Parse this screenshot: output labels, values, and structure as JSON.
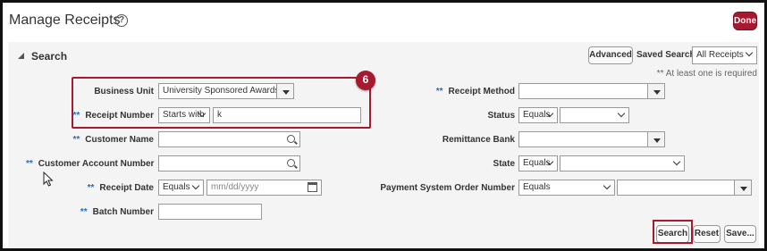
{
  "header": {
    "title": "Manage Receipts",
    "help_icon": "?",
    "done_label": "Done"
  },
  "search": {
    "section_title": "Search",
    "advanced_label": "Advanced",
    "saved_search_label": "Saved Search",
    "saved_search_value": "All Receipts",
    "at_least_one_note": "** At least one is required",
    "required_marker": "**",
    "fields": {
      "business_unit": {
        "label": "Business Unit",
        "value": "University Sponsored Awards"
      },
      "receipt_number": {
        "label": "Receipt Number",
        "operator": "Starts with",
        "value": "k"
      },
      "customer_name": {
        "label": "Customer Name",
        "value": ""
      },
      "customer_account_number": {
        "label": "Customer Account Number",
        "value": ""
      },
      "receipt_date": {
        "label": "Receipt Date",
        "operator": "Equals",
        "placeholder": "mm/dd/yyyy"
      },
      "batch_number": {
        "label": "Batch Number",
        "value": ""
      },
      "receipt_method": {
        "label": "Receipt Method",
        "value": ""
      },
      "status": {
        "label": "Status",
        "operator": "Equals",
        "value": ""
      },
      "remittance_bank": {
        "label": "Remittance Bank",
        "value": ""
      },
      "state": {
        "label": "State",
        "operator": "Equals",
        "value": ""
      },
      "payment_system_order_number": {
        "label": "Payment System Order Number",
        "operator": "Equals",
        "value": ""
      }
    },
    "buttons": {
      "search": "Search",
      "reset": "Reset",
      "save": "Save..."
    }
  },
  "annotation": {
    "step_number": "6",
    "accent_color": "#a6192e"
  },
  "colors": {
    "required_marker": "#2a6ebb",
    "panel_bg": "#f4f4f4",
    "done_bg": "#a6192e"
  }
}
